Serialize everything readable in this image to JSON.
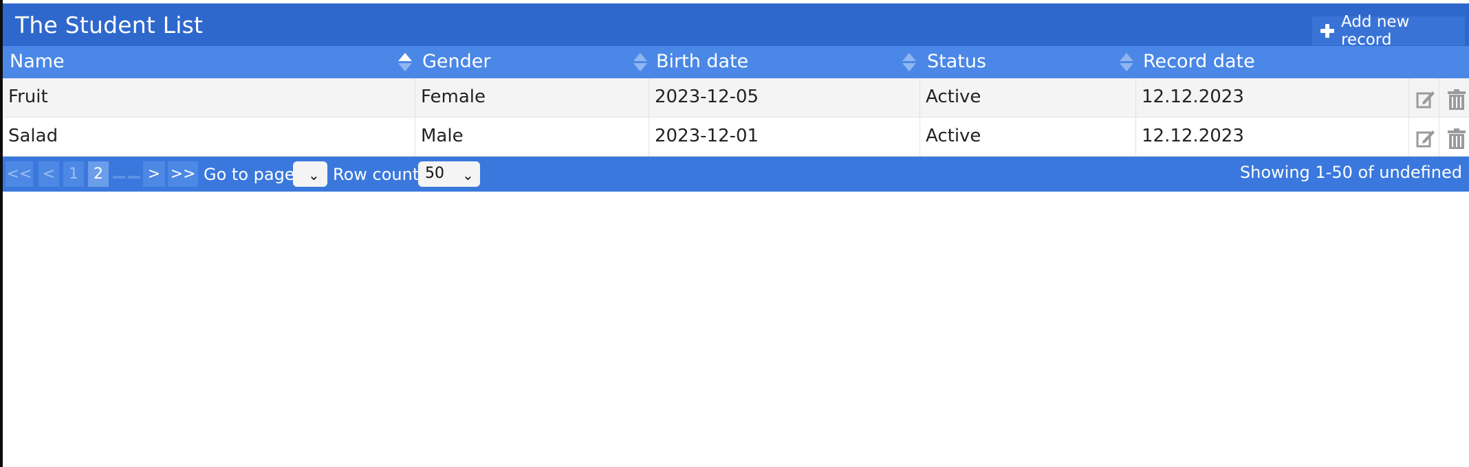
{
  "title": "The Student List",
  "toolbar": {
    "add_label": "Add new record",
    "add_icon": "plus-icon"
  },
  "columns": [
    {
      "label": "Name",
      "sort": "ascending"
    },
    {
      "label": "Gender",
      "sort": "none"
    },
    {
      "label": "Birth date",
      "sort": "none"
    },
    {
      "label": "Status",
      "sort": "none"
    },
    {
      "label": "Record date",
      "sort": "none"
    }
  ],
  "rows": [
    {
      "name": "Fruit",
      "gender": "Female",
      "birth_date": "2023-12-05",
      "status": "Active",
      "record_date": "12.12.2023"
    },
    {
      "name": "Salad",
      "gender": "Male",
      "birth_date": "2023-12-01",
      "status": "Active",
      "record_date": "12.12.2023"
    }
  ],
  "row_actions": {
    "edit_icon": "edit-icon",
    "delete_icon": "trash-icon"
  },
  "pager": {
    "first": "<<",
    "prev": "<",
    "pages": [
      "1",
      "2"
    ],
    "current_page": "2",
    "next": ">",
    "last": ">>",
    "goto_label": "Go to page:",
    "goto_value": "",
    "rowcount_label": "Row count:",
    "rowcount_value": "50",
    "showing": "Showing 1-50 of undefined"
  },
  "colors": {
    "title_bar": "#2f68cc",
    "header_row": "#4a87e6",
    "footer": "#3a78dd",
    "row_alt": "#f4f4f4"
  }
}
